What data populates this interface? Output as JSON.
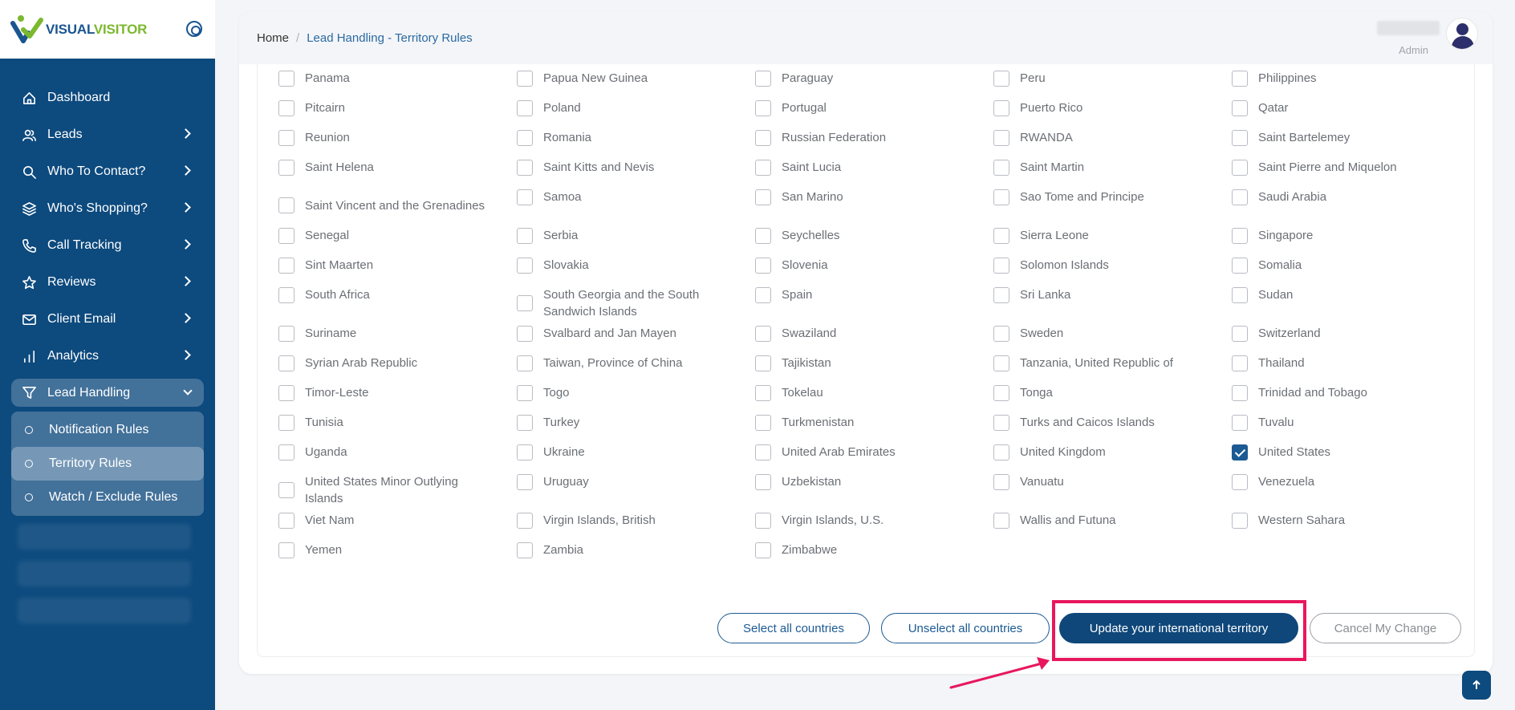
{
  "brand": {
    "part1": "VISUAL",
    "part2": "VISITOR"
  },
  "sidebar": {
    "items": [
      {
        "label": "Dashboard",
        "icon": "home-icon",
        "has_arrow": false
      },
      {
        "label": "Leads",
        "icon": "users-icon",
        "has_arrow": true
      },
      {
        "label": "Who To Contact?",
        "icon": "search-icon",
        "has_arrow": true
      },
      {
        "label": "Who's Shopping?",
        "icon": "layers-icon",
        "has_arrow": true
      },
      {
        "label": "Call Tracking",
        "icon": "phone-icon",
        "has_arrow": true
      },
      {
        "label": "Reviews",
        "icon": "star-icon",
        "has_arrow": true
      },
      {
        "label": "Client Email",
        "icon": "mail-icon",
        "has_arrow": true
      },
      {
        "label": "Analytics",
        "icon": "bar-chart-icon",
        "has_arrow": true
      }
    ],
    "active": {
      "label": "Lead Handling",
      "icon": "filter-icon"
    },
    "subitems": [
      {
        "label": "Notification Rules"
      },
      {
        "label": "Territory Rules"
      },
      {
        "label": "Watch / Exclude Rules"
      }
    ]
  },
  "breadcrumb": {
    "home": "Home",
    "separator": "/",
    "current": "Lead Handling - Territory Rules"
  },
  "user": {
    "role": "Admin"
  },
  "countries": [
    [
      "Panama",
      "Papua New Guinea",
      "Paraguay",
      "Peru",
      "Philippines"
    ],
    [
      "Pitcairn",
      "Poland",
      "Portugal",
      "Puerto Rico",
      "Qatar"
    ],
    [
      "Reunion",
      "Romania",
      "Russian Federation",
      "RWANDA",
      "Saint Bartelemey"
    ],
    [
      "Saint Helena",
      "Saint Kitts and Nevis",
      "Saint Lucia",
      "Saint Martin",
      "Saint Pierre and Miquelon"
    ],
    [
      "Saint Vincent and the Grenadines",
      "Samoa",
      "San Marino",
      "Sao Tome and Principe",
      "Saudi Arabia"
    ],
    [
      "Senegal",
      "Serbia",
      "Seychelles",
      "Sierra Leone",
      "Singapore"
    ],
    [
      "Sint Maarten",
      "Slovakia",
      "Slovenia",
      "Solomon Islands",
      "Somalia"
    ],
    [
      "South Africa",
      "South Georgia and the South Sandwich Islands",
      "Spain",
      "Sri Lanka",
      "Sudan"
    ],
    [
      "Suriname",
      "Svalbard and Jan Mayen",
      "Swaziland",
      "Sweden",
      "Switzerland"
    ],
    [
      "Syrian Arab Republic",
      "Taiwan, Province of China",
      "Tajikistan",
      "Tanzania, United Republic of",
      "Thailand"
    ],
    [
      "Timor-Leste",
      "Togo",
      "Tokelau",
      "Tonga",
      "Trinidad and Tobago"
    ],
    [
      "Tunisia",
      "Turkey",
      "Turkmenistan",
      "Turks and Caicos Islands",
      "Tuvalu"
    ],
    [
      "Uganda",
      "Ukraine",
      "United Arab Emirates",
      "United Kingdom",
      "United States"
    ],
    [
      "United States Minor Outlying Islands",
      "Uruguay",
      "Uzbekistan",
      "Vanuatu",
      "Venezuela"
    ],
    [
      "Viet Nam",
      "Virgin Islands, British",
      "Virgin Islands, U.S.",
      "Wallis and Futuna",
      "Western Sahara"
    ],
    [
      "Yemen",
      "Zambia",
      "Zimbabwe"
    ]
  ],
  "checked": [
    "United States"
  ],
  "buttons": {
    "select_all": "Select all countries",
    "unselect_all": "Unselect all countries",
    "update": "Update your international territory",
    "cancel": "Cancel My Change"
  },
  "colors": {
    "sidebar": "#0d4a7e",
    "primary": "#0f477a",
    "highlight": "#e8175d",
    "link": "#2a6aa1"
  }
}
